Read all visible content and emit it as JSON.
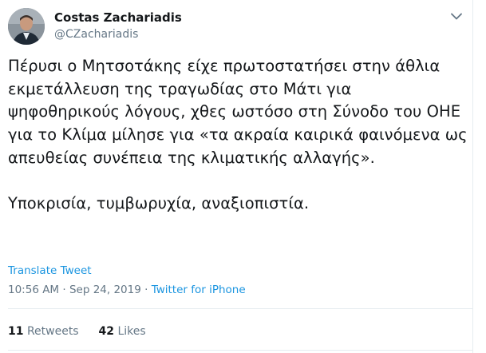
{
  "author": {
    "name": "Costas Zachariadis",
    "handle": "@CZachariadis"
  },
  "tweet": {
    "paragraph1": "Πέρυσι ο Μητσοτάκης είχε πρωτοστατήσει στην άθλια εκμετάλλευση της τραγωδίας στο Μάτι για ψηφοθηρικούς λόγους, χθες ωστόσο στη Σύνοδο του ΟΗΕ για το Κλίμα μίλησε για «τα ακραία καιρικά φαινόμενα ως απευθείας συνέπεια της κλιματικής αλλαγής».",
    "paragraph2": "Υποκρισία, τυμβωρυχία, αναξιοπιστία."
  },
  "translate_label": "Translate Tweet",
  "meta": {
    "time": "10:56 AM",
    "separator1": " · ",
    "date": "Sep 24, 2019",
    "separator2": " · ",
    "source": "Twitter for iPhone"
  },
  "stats": {
    "retweets_count": "11",
    "retweets_label": "Retweets",
    "likes_count": "42",
    "likes_label": "Likes"
  },
  "icons": {
    "caret": "chevron-down-icon"
  },
  "colors": {
    "link": "#1b95e0",
    "secondary_text": "#657786",
    "divider": "#e6ecf0"
  }
}
